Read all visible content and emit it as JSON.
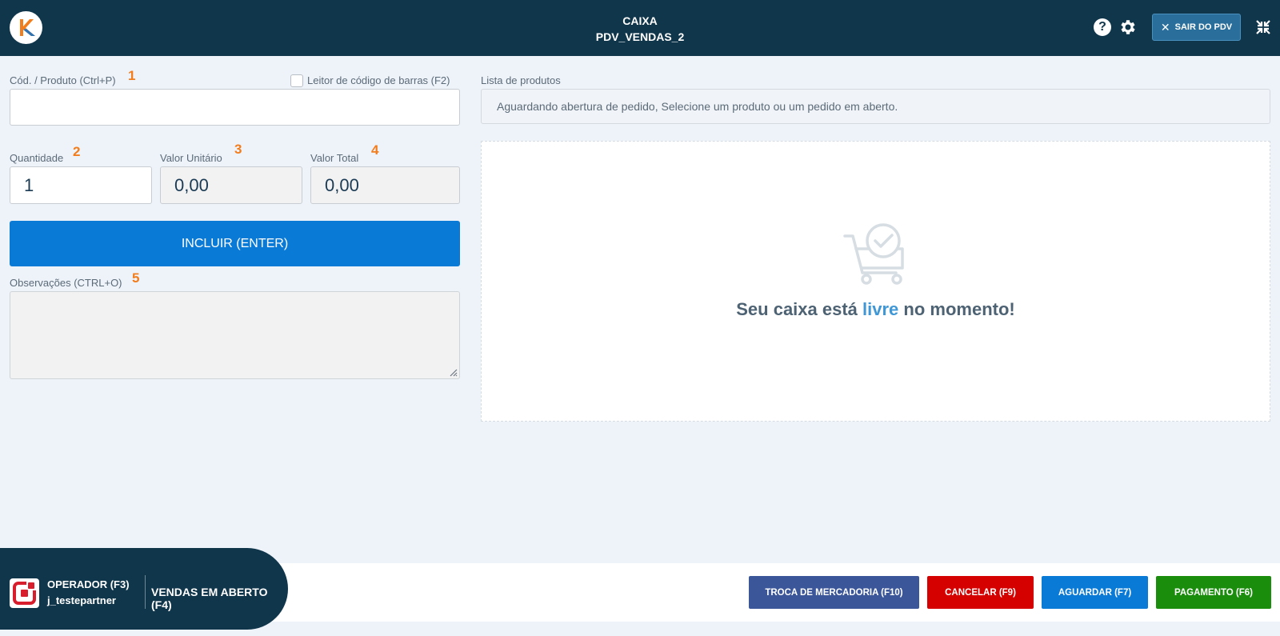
{
  "header": {
    "title_line1": "CAIXA",
    "title_line2": "PDV_VENDAS_2",
    "exit_label": "SAIR DO PDV",
    "icons": [
      "logo-icon",
      "help-icon",
      "gear-icon",
      "close-icon",
      "shrink-icon"
    ]
  },
  "form": {
    "product": {
      "label": "Cód. / Produto (Ctrl+P)",
      "badge": "1",
      "value": ""
    },
    "barcode": {
      "label": "Leitor de código de barras (F2)",
      "checked": false
    },
    "quantity": {
      "label": "Quantidade",
      "badge": "2",
      "value": "1"
    },
    "unit_price": {
      "label": "Valor Unitário",
      "badge": "3",
      "value": "0,00"
    },
    "total_price": {
      "label": "Valor Total",
      "badge": "4",
      "value": "0,00"
    },
    "include_button": "INCLUIR (ENTER)",
    "notes": {
      "label": "Observações (CTRL+O)",
      "badge": "5",
      "value": ""
    }
  },
  "products": {
    "label": "Lista de produtos",
    "status": "Aguardando abertura de pedido, Selecione um produto ou um pedido em aberto.",
    "empty_prefix": "Seu caixa está ",
    "empty_highlight": "livre",
    "empty_suffix": " no momento!"
  },
  "footer": {
    "operator_label": "OPERADOR (F3)",
    "operator_user": "j_testepartner",
    "open_sales": "VENDAS EM ABERTO (F4)",
    "buttons": [
      {
        "label": "TROCA DE MERCADORIA (F10)",
        "color": "#3b5699"
      },
      {
        "label": "CANCELAR (F9)",
        "color": "#d50000"
      },
      {
        "label": "AGUARDAR (F7)",
        "color": "#0a7ad7"
      },
      {
        "label": "PAGAMENTO (F6)",
        "color": "#1a8d0d"
      }
    ]
  },
  "colors": {
    "header_bg": "#10364b",
    "accent_orange": "#f27d1d",
    "primary_blue": "#0a7ad7",
    "highlight_text": "#3f97d6"
  }
}
